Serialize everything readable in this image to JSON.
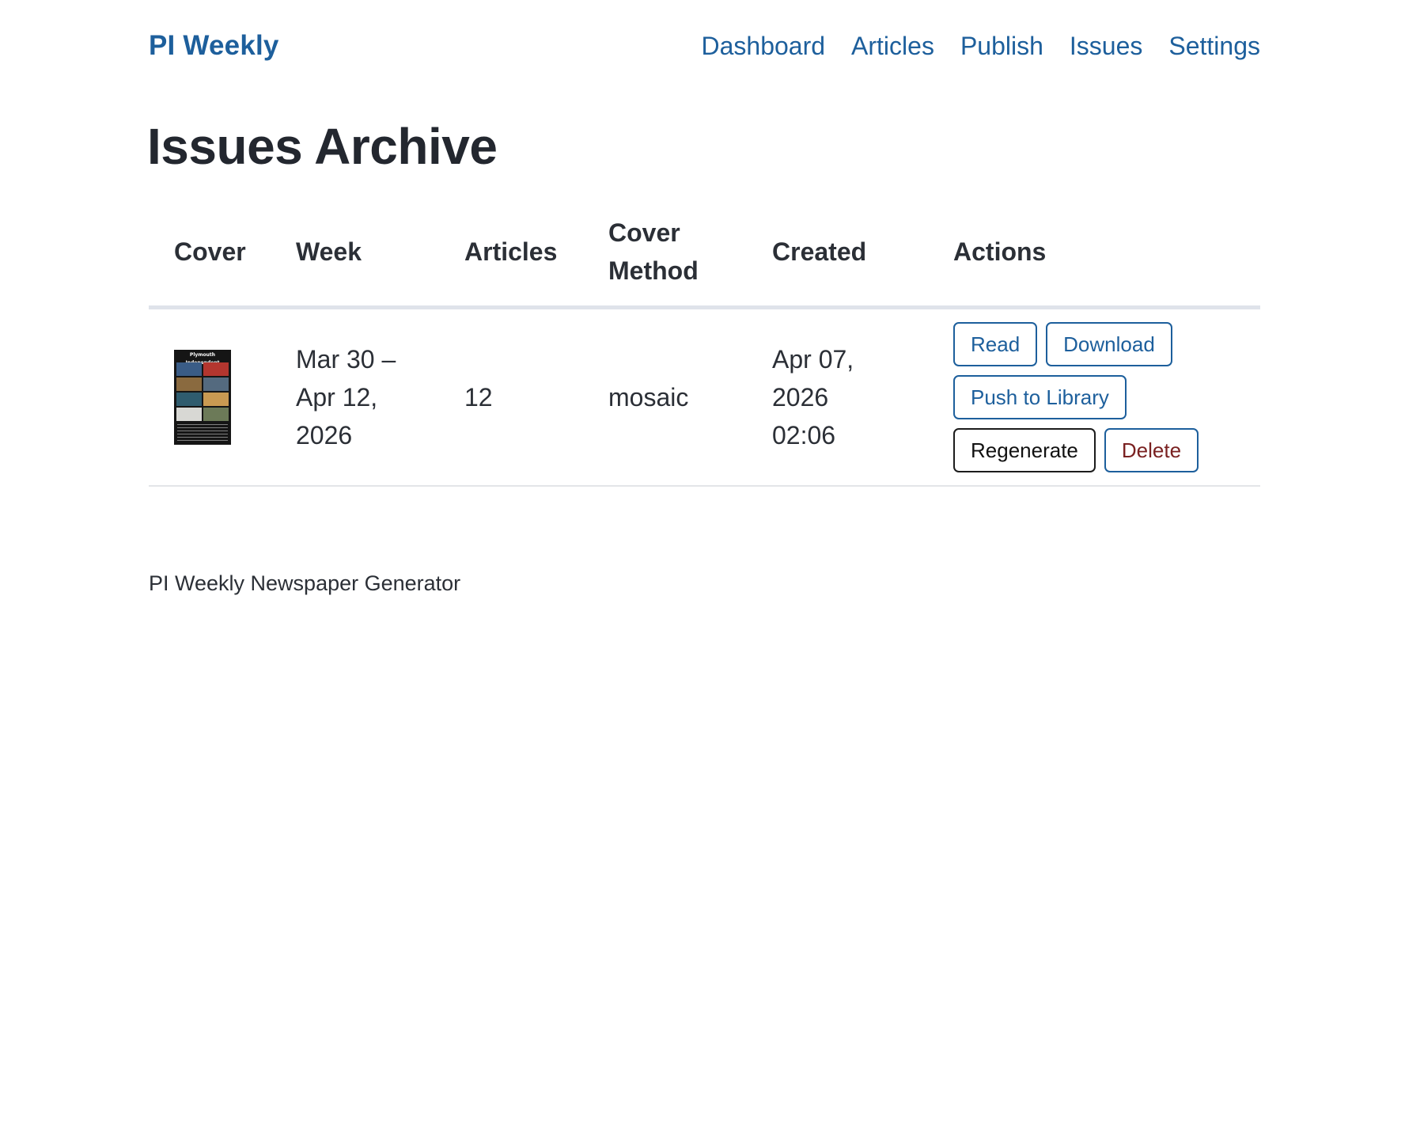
{
  "header": {
    "brand": "PI Weekly",
    "nav": [
      "Dashboard",
      "Articles",
      "Publish",
      "Issues",
      "Settings"
    ]
  },
  "page": {
    "title": "Issues Archive"
  },
  "table": {
    "columns": {
      "cover": "Cover",
      "week": "Week",
      "articles": "Articles",
      "cover_method": "Cover Method",
      "created": "Created",
      "actions": "Actions"
    },
    "rows": [
      {
        "cover_masthead": "Plymouth Independent",
        "week": "Mar 30 – Apr 12, 2026",
        "articles": "12",
        "cover_method": "mosaic",
        "created": "Apr 07, 2026 02:06",
        "actions": {
          "read": "Read",
          "download": "Download",
          "push": "Push to Library",
          "regenerate": "Regenerate",
          "delete": "Delete"
        }
      }
    ]
  },
  "footer": {
    "text": "PI Weekly Newspaper Generator"
  },
  "colors": {
    "accent": "#1d5f9c",
    "danger_text": "#7a2121",
    "text": "#23272f"
  }
}
